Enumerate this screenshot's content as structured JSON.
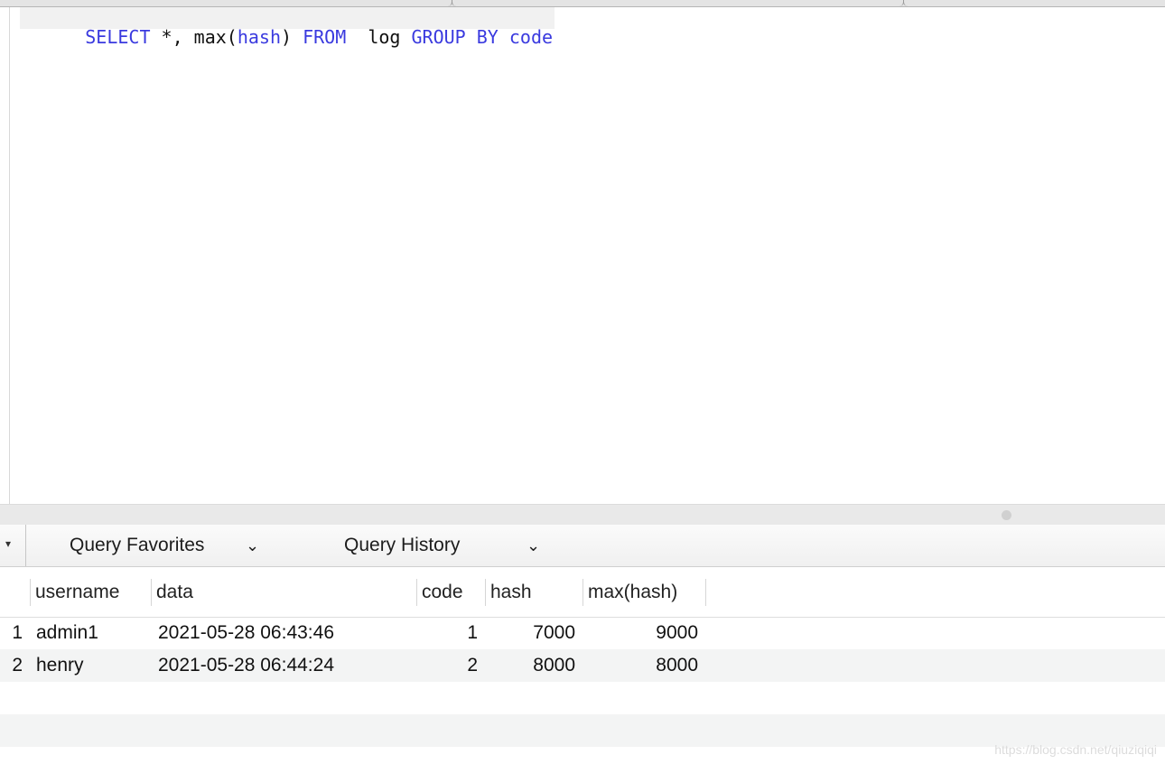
{
  "editor": {
    "tokens": [
      {
        "text": "SELECT",
        "kind": "keyword"
      },
      {
        "text": " *, max(",
        "kind": "text"
      },
      {
        "text": "hash",
        "kind": "keyword"
      },
      {
        "text": ") ",
        "kind": "text"
      },
      {
        "text": "FROM",
        "kind": "keyword"
      },
      {
        "text": "  log ",
        "kind": "text"
      },
      {
        "text": "GROUP BY",
        "kind": "keyword"
      },
      {
        "text": " ",
        "kind": "text"
      },
      {
        "text": "code",
        "kind": "keyword"
      }
    ]
  },
  "query_bar": {
    "favorites_label": "Query Favorites",
    "history_label": "Query History",
    "menu_arrow": "▾",
    "chevron": "⌄"
  },
  "results": {
    "columns": [
      "username",
      "data",
      "code",
      "hash",
      "max(hash)"
    ],
    "rows": [
      {
        "num": "1",
        "username": "admin1",
        "data": "2021-05-28 06:43:46",
        "code": "1",
        "hash": "7000",
        "max_hash": "9000"
      },
      {
        "num": "2",
        "username": "henry",
        "data": "2021-05-28 06:44:24",
        "code": "2",
        "hash": "8000",
        "max_hash": "8000"
      }
    ]
  },
  "watermark": "https://blog.csdn.net/qiuziqiqi",
  "colors": {
    "keyword": "#3a3adf",
    "text": "#111111",
    "alt_row": "#f3f4f4"
  }
}
